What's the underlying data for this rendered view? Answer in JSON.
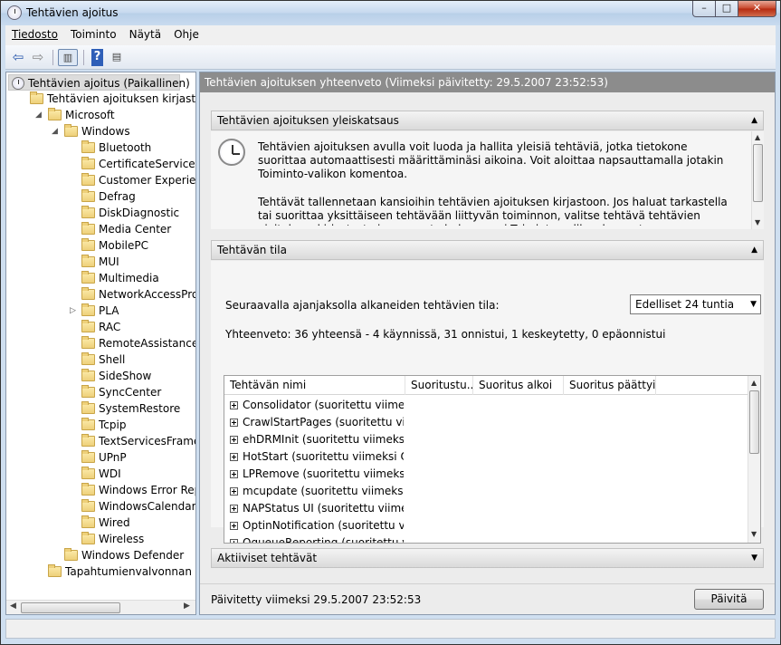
{
  "window": {
    "title": "Tehtävien ajoitus",
    "min": "–",
    "max": "□",
    "close": "✕"
  },
  "menu": [
    "Tiedosto",
    "Toiminto",
    "Näytä",
    "Ohje"
  ],
  "toolbar": {
    "back_icon": "back-arrow-icon",
    "forward_icon": "forward-arrow-icon",
    "help": "?"
  },
  "tree": {
    "root": "Tehtävien ajoitus  (Paikallinen)",
    "library": "Tehtävien ajoituksen kirjasto",
    "microsoft": "Microsoft",
    "windows": "Windows",
    "children": [
      "Bluetooth",
      "CertificateServicesC",
      "Customer Experienc",
      "Defrag",
      "DiskDiagnostic",
      "Media Center",
      "MobilePC",
      "MUI",
      "Multimedia",
      "NetworkAccessProt",
      "PLA",
      "RAC",
      "RemoteAssistance",
      "Shell",
      "SideShow",
      "SyncCenter",
      "SystemRestore",
      "Tcpip",
      "TextServicesFramew",
      "UPnP",
      "WDI",
      "Windows Error Repo",
      "WindowsCalendar",
      "Wired",
      "Wireless"
    ],
    "defender": "Windows Defender",
    "eventviewer": "Tapahtumienvalvonnan teh"
  },
  "summary_header": "Tehtävien ajoituksen yhteenveto (Viimeksi päivitetty: 29.5.2007 23:52:53)",
  "overview": {
    "title": "Tehtävien ajoituksen yleiskatsaus",
    "p1": "Tehtävien ajoituksen avulla voit luoda ja hallita yleisiä tehtäviä, jotka tietokone suorittaa automaattisesti määrittäminäsi aikoina. Voit aloittaa napsauttamalla jotakin Toiminto-valikon komentoa.",
    "p2": "Tehtävät tallennetaan kansioihin tehtävien ajoituksen kirjastoon. Jos haluat tarkastella tai suorittaa yksittäiseen tehtävään liittyvän toiminnon, valitse tehtävä tehtävien ajoituksen kirjastosta ja napsauta haluamaasi Toiminto-valikon komentoa."
  },
  "status": {
    "title": "Tehtävän tila",
    "period_label": "Seuraavalla ajanjaksolla alkaneiden tehtävien tila:",
    "period_value": "Edelliset 24 tuntia",
    "summary": "Yhteenveto: 36 yhteensä - 4 käynnissä, 31 onnistui, 1 keskeytetty, 0 epäonnistui",
    "columns": [
      "Tehtävän nimi",
      "Suoritustu...",
      "Suoritus alkoi",
      "Suoritus päättyi"
    ],
    "rows": [
      "Consolidator (suoritettu viimek...",
      "CrawlStartPages (suoritettu vii...",
      "ehDRMInit (suoritettu viimeksi ...",
      "HotStart (suoritettu viimeksi On...",
      "LPRemove (suoritettu viimeksi ...",
      "mcupdate (suoritettu viimeksi ...",
      "NAPStatus UI (suoritettu viimek...",
      "OptinNotification (suoritettu vii...",
      "OqueueReporting (suoritettu vi..."
    ]
  },
  "active": {
    "title": "Aktiiviset tehtävät"
  },
  "footer": {
    "updated": "Päivitetty viimeksi 29.5.2007 23:52:53",
    "refresh": "Päivitä"
  }
}
